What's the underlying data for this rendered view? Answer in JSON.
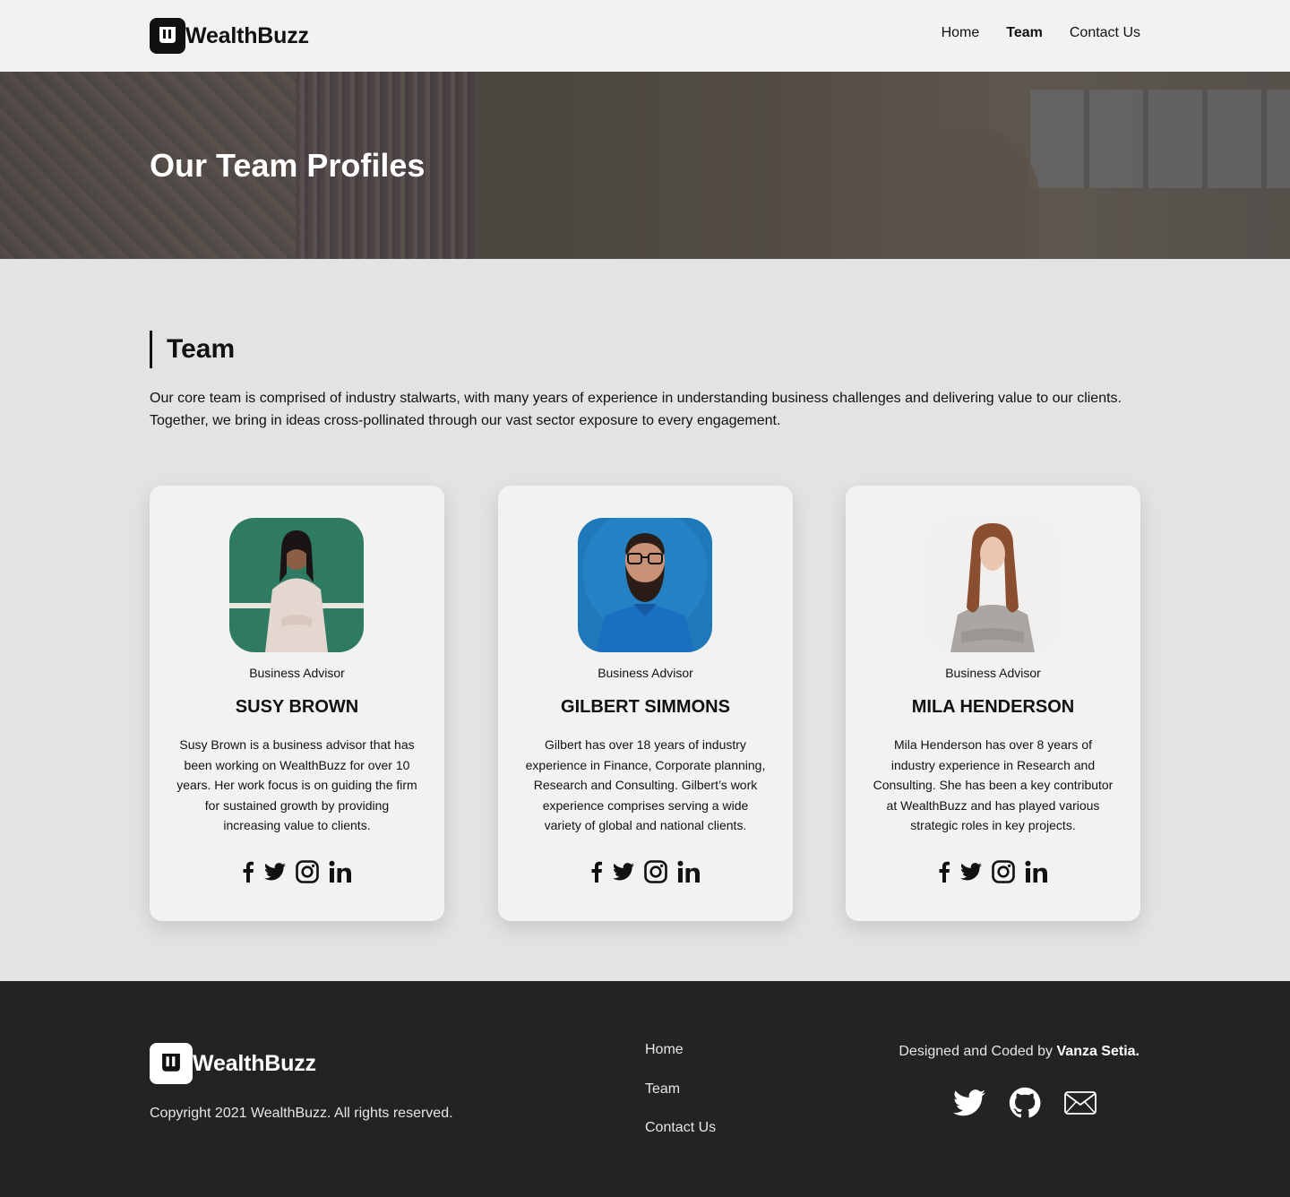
{
  "header": {
    "brand": "WealthBuzz",
    "nav": [
      {
        "label": "Home"
      },
      {
        "label": "Team"
      },
      {
        "label": "Contact Us"
      }
    ]
  },
  "hero": {
    "title": "Our Team Profiles"
  },
  "team": {
    "heading": "Team",
    "description": "Our core team is comprised of industry stalwarts, with many years of experience in understanding business challenges and delivering value to our clients. Together, we bring in ideas cross-pollinated through our vast sector exposure to every engagement.",
    "members": [
      {
        "role": "Business Advisor",
        "name": "SUSY BROWN",
        "bio": "Susy Brown is a business advisor that has been working on WealthBuzz for over 10 years. Her work focus is on guiding the firm for sustained growth by providing increasing value to clients."
      },
      {
        "role": "Business Advisor",
        "name": "GILBERT SIMMONS",
        "bio": "Gilbert has over 18 years of industry experience in Finance, Corporate planning, Research and Consulting. Gilbert’s work experience comprises serving a wide variety of global and national clients."
      },
      {
        "role": "Business Advisor",
        "name": "MILA HENDERSON",
        "bio": "Mila Henderson has over 8 years of industry experience in Research and Consulting. She has been a key contributor at WealthBuzz and has played various strategic roles in key projects."
      }
    ],
    "social_icons": [
      "facebook-icon",
      "twitter-icon",
      "instagram-icon",
      "linkedin-icon"
    ]
  },
  "footer": {
    "brand": "WealthBuzz",
    "copyright": "Copyright 2021 WealthBuzz. All rights reserved.",
    "links": [
      {
        "label": "Home"
      },
      {
        "label": "Team"
      },
      {
        "label": "Contact Us"
      }
    ],
    "credit_prefix": "Designed and Coded by",
    "credit_name": "Vanza Setia.",
    "icons": [
      "twitter-icon",
      "github-icon",
      "mail-icon"
    ]
  },
  "colors": {
    "header_bg": "#f2f2f2",
    "page_bg": "#e3e3e3",
    "card_bg": "#f2f2f2",
    "footer_bg": "#232323",
    "text": "#111111"
  }
}
